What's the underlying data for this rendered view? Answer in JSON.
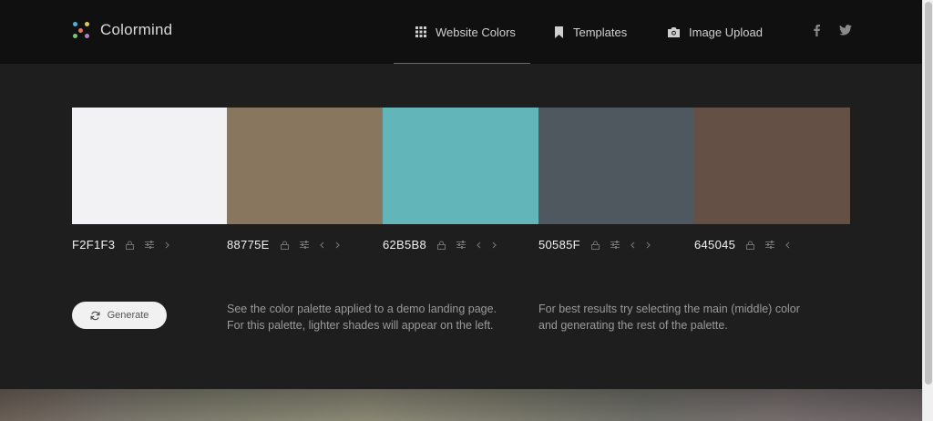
{
  "brand": {
    "name": "Colormind"
  },
  "nav": [
    {
      "label": "Website Colors",
      "icon": "grid-icon",
      "active": true
    },
    {
      "label": "Templates",
      "icon": "bookmark-icon",
      "active": false
    },
    {
      "label": "Image Upload",
      "icon": "camera-icon",
      "active": false
    }
  ],
  "social": {
    "facebook": "f",
    "twitter": "twitter"
  },
  "palette": [
    {
      "hex": "F2F1F3",
      "color": "#F2F1F3"
    },
    {
      "hex": "88775E",
      "color": "#88775E"
    },
    {
      "hex": "62B5B8",
      "color": "#62B5B8"
    },
    {
      "hex": "50585F",
      "color": "#50585F"
    },
    {
      "hex": "645045",
      "color": "#645045"
    }
  ],
  "generate": {
    "label": "Generate"
  },
  "info": {
    "left_line1": "See the color palette applied to a demo landing page.",
    "left_line2": "For this palette, lighter shades will appear on the left.",
    "right_line1": "For best results try selecting the main (middle) color",
    "right_line2": "and generating the rest of the palette."
  },
  "colors": {
    "header_bg": "#101010",
    "page_bg": "#1E1E1E",
    "button_bg": "#F1F1F1"
  }
}
